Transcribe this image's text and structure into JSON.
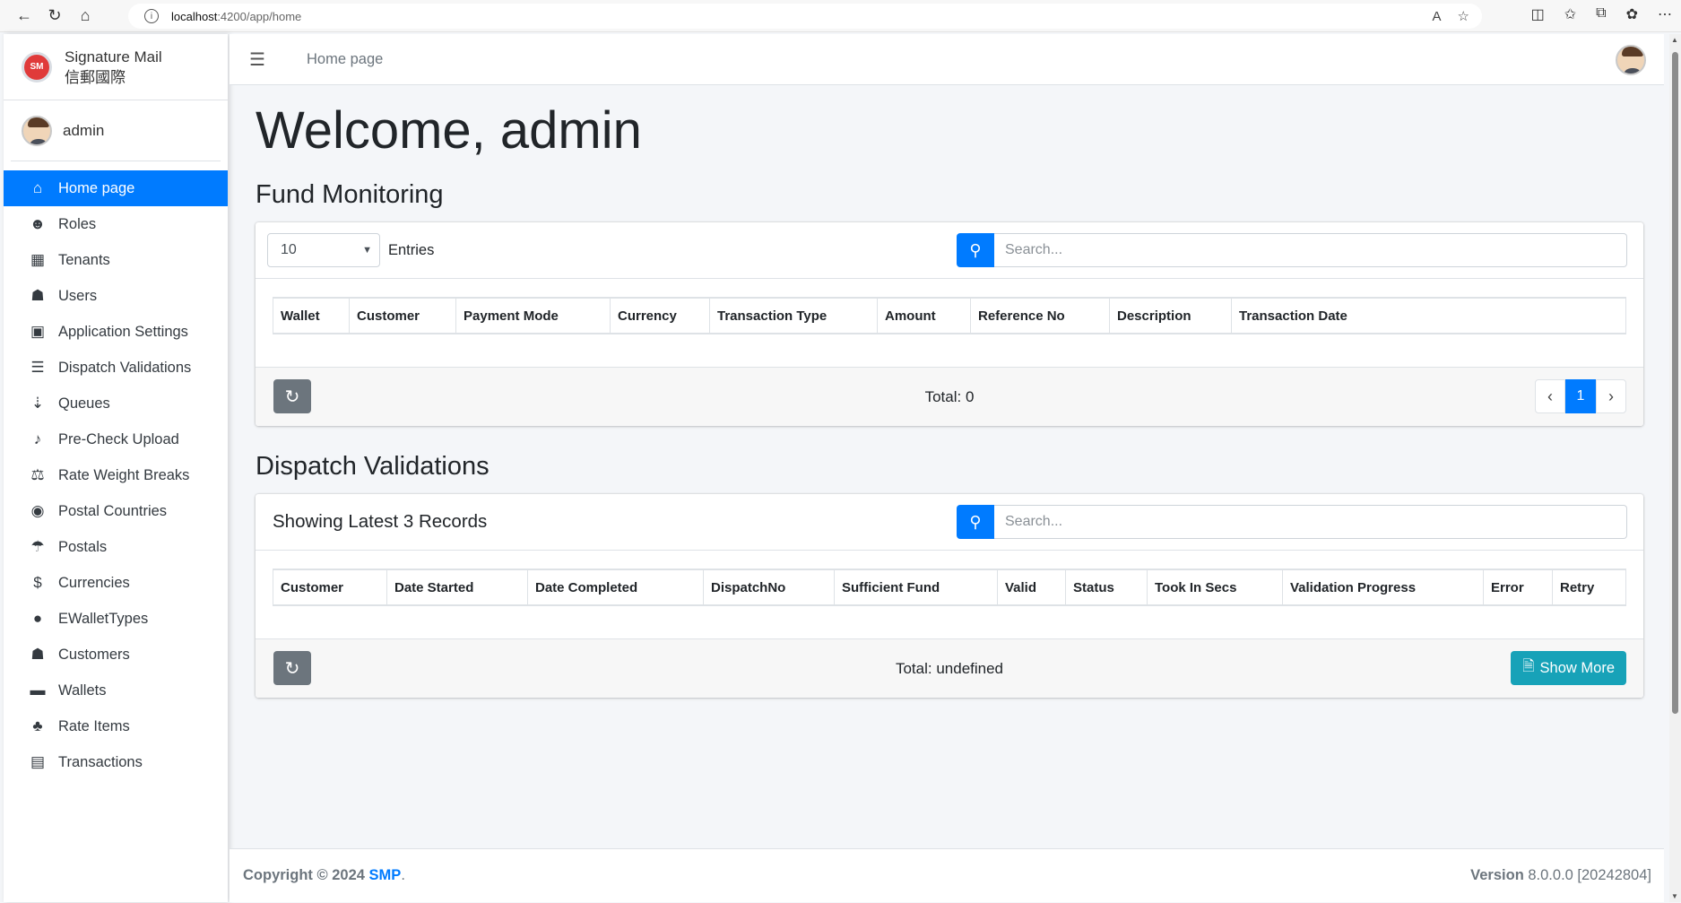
{
  "browser": {
    "url_host": "localhost",
    "url_path": ":4200/app/home"
  },
  "brand": {
    "name": "Signature Mail",
    "subtitle": "信郵國際"
  },
  "user": {
    "name": "admin"
  },
  "sidebar": {
    "items": [
      {
        "label": "Home page",
        "icon": "⌂"
      },
      {
        "label": "Roles",
        "icon": "☻"
      },
      {
        "label": "Tenants",
        "icon": "▦"
      },
      {
        "label": "Users",
        "icon": "☗"
      },
      {
        "label": "Application Settings",
        "icon": "▣"
      },
      {
        "label": "Dispatch Validations",
        "icon": "☰"
      },
      {
        "label": "Queues",
        "icon": "⇣"
      },
      {
        "label": "Pre-Check Upload",
        "icon": "♪"
      },
      {
        "label": "Rate Weight Breaks",
        "icon": "⚖"
      },
      {
        "label": "Postal Countries",
        "icon": "◉"
      },
      {
        "label": "Postals",
        "icon": "☂"
      },
      {
        "label": "Currencies",
        "icon": "$"
      },
      {
        "label": "EWalletTypes",
        "icon": "●"
      },
      {
        "label": "Customers",
        "icon": "☗"
      },
      {
        "label": "Wallets",
        "icon": "▬"
      },
      {
        "label": "Rate Items",
        "icon": "♣"
      },
      {
        "label": "Transactions",
        "icon": "▤"
      }
    ]
  },
  "topbar": {
    "breadcrumb": "Home page"
  },
  "main": {
    "welcome": "Welcome, admin",
    "fund": {
      "title": "Fund Monitoring",
      "entries_value": "10",
      "entries_label": "Entries",
      "search_placeholder": "Search...",
      "columns": [
        "Wallet",
        "Customer",
        "Payment Mode",
        "Currency",
        "Transaction Type",
        "Amount",
        "Reference No",
        "Description",
        "Transaction Date"
      ],
      "total": "Total: 0",
      "page": "1"
    },
    "dispatch": {
      "title": "Dispatch Validations",
      "latest": "Showing Latest 3 Records",
      "search_placeholder": "Search...",
      "columns": [
        "Customer",
        "Date Started",
        "Date Completed",
        "DispatchNo",
        "Sufficient Fund",
        "Valid",
        "Status",
        "Took In Secs",
        "Validation Progress",
        "Error",
        "Retry"
      ],
      "total": "Total: undefined",
      "show_more": "Show More"
    }
  },
  "footer": {
    "copyright_prefix": "Copyright © 2024",
    "link": "SMP",
    "period": ".",
    "version_label": "Version",
    "version_value": "8.0.0.0 [20242804]"
  },
  "colors": {
    "primary": "#007bff",
    "info": "#17a2b8",
    "secondary": "#6c757d"
  }
}
